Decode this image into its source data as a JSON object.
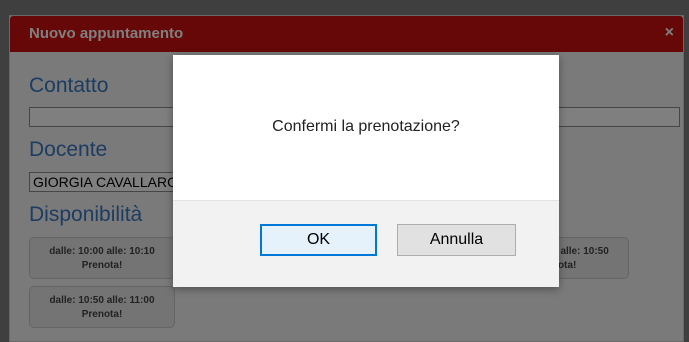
{
  "panel": {
    "title": "Nuovo appuntamento",
    "close_icon": "×",
    "contatto_label": "Contatto",
    "contatto_value": "",
    "docente_label": "Docente",
    "docente_value": "GIORGIA CAVALLARO",
    "disponibilita_label": "Disponibilità",
    "slots": [
      {
        "time": "dalle: 10:00 alle: 10:10",
        "action": "Prenota!"
      },
      {
        "time": "dalle: 10:40 alle: 10:50",
        "action": "Prenota!"
      },
      {
        "time": "dalle: 10:50 alle: 11:00",
        "action": "Prenota!"
      }
    ]
  },
  "dialog": {
    "message": "Confermi la prenotazione?",
    "ok_label": "OK",
    "cancel_label": "Annulla"
  },
  "colors": {
    "header": "#cc1010",
    "section_label": "#3a79c3",
    "ok_border": "#0078d7"
  }
}
